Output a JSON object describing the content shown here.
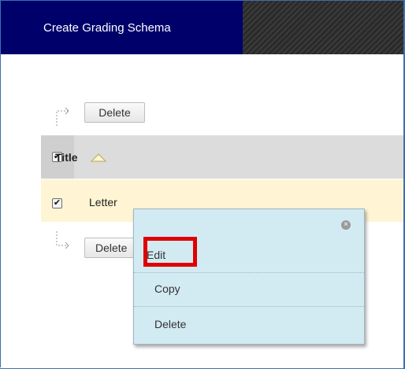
{
  "action_bar": {
    "create_label": "Create Grading Schema"
  },
  "toolbar_top": {
    "delete_label": "Delete"
  },
  "toolbar_bottom": {
    "delete_label": "Delete"
  },
  "table": {
    "header": {
      "title_label": "Title",
      "select_all_checked": true,
      "sort": "ascending"
    },
    "rows": [
      {
        "title": "Letter",
        "checked": true
      }
    ]
  },
  "context_menu": {
    "items": [
      {
        "label": "Edit"
      },
      {
        "label": "Copy"
      },
      {
        "label": "Delete"
      }
    ],
    "close_icon": "close-icon",
    "highlighted_item": "Edit"
  },
  "colors": {
    "action_bar": "#00006b",
    "header_row": "#d3d3d3",
    "row_highlight": "#fff5d4",
    "menu_bg": "#d2ebf3",
    "highlight_border": "#e00000"
  }
}
